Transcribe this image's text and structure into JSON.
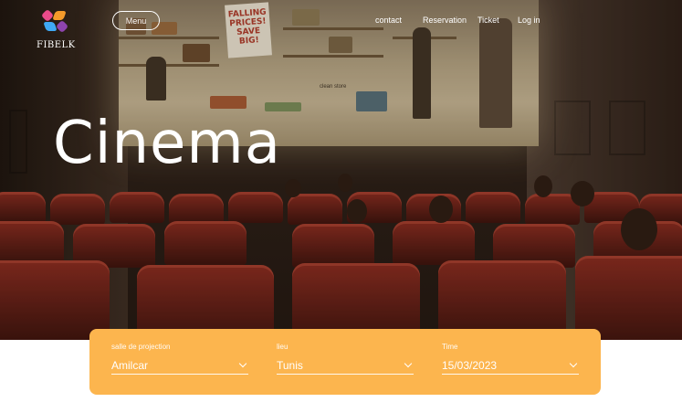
{
  "brand": {
    "name": "FIBELK",
    "tagline": ""
  },
  "nav": {
    "menu_label": "Menu",
    "links": [
      "contact",
      "Reservation",
      "Ticket",
      "Log in"
    ]
  },
  "hero": {
    "title": "Cinema",
    "screen_sign": "FALLING PRICES! SAVE BIG!",
    "screen_caption": "clean store"
  },
  "search": {
    "fields": [
      {
        "label": "salle de projection",
        "value": "Amilcar"
      },
      {
        "label": "lieu",
        "value": "Tunis"
      },
      {
        "label": "Time",
        "value": "15/03/2023"
      }
    ]
  },
  "colors": {
    "accent": "#fcb54e",
    "seat": "#8c2a1f",
    "text": "#ffffff"
  }
}
